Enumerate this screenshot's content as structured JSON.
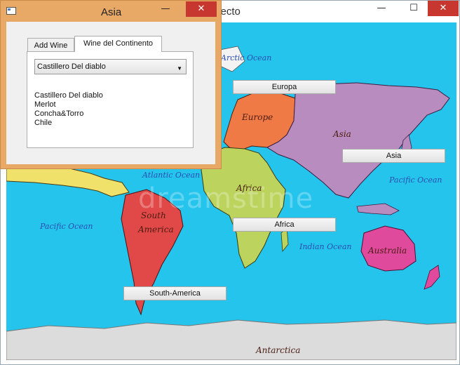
{
  "back_window": {
    "title": "yecto",
    "controls": {
      "minimize": "—",
      "maximize": "☐",
      "close": "✕"
    },
    "map": {
      "ocean_labels": {
        "arctic": "Arctic Ocean",
        "atlantic": "Atlantic Ocean",
        "pacific_left": "Pacific Ocean",
        "pacific_right": "Pacific Ocean",
        "indian": "Indian Ocean"
      },
      "land_labels": {
        "europe": "Europe",
        "asia": "Asia",
        "africa": "Africa",
        "south_america_1": "South",
        "south_america_2": "America",
        "australia": "Australia",
        "antarctica": "Antarctica"
      },
      "watermark": "dreamstime",
      "colors": {
        "ocean": "#25c4ec",
        "europe": "#f07a45",
        "asia": "#b98cc0",
        "africa": "#bcd35e",
        "south_america": "#e14848",
        "north_america": "#efe16a",
        "australia": "#e04a9c",
        "antarctica": "#dcdcdc"
      }
    },
    "continent_buttons": {
      "europa": "Europa",
      "asia": "Asia",
      "africa": "Africa",
      "south_america": "South-America"
    }
  },
  "dialog": {
    "title": "Asia",
    "controls": {
      "minimize": "—",
      "maximize": "☐",
      "close": "✕"
    },
    "tabs": [
      {
        "label": "Add Wine",
        "active": false
      },
      {
        "label": "Wine del Continento",
        "active": true
      }
    ],
    "combo": {
      "selected": "Castillero Del diablo"
    },
    "wine_info": {
      "name": "Castillero Del diablo",
      "type": "Merlot",
      "producer": "Concha&Torro",
      "country": "Chile"
    },
    "colors": {
      "frame": "#e8a967",
      "close": "#c7372f"
    }
  }
}
